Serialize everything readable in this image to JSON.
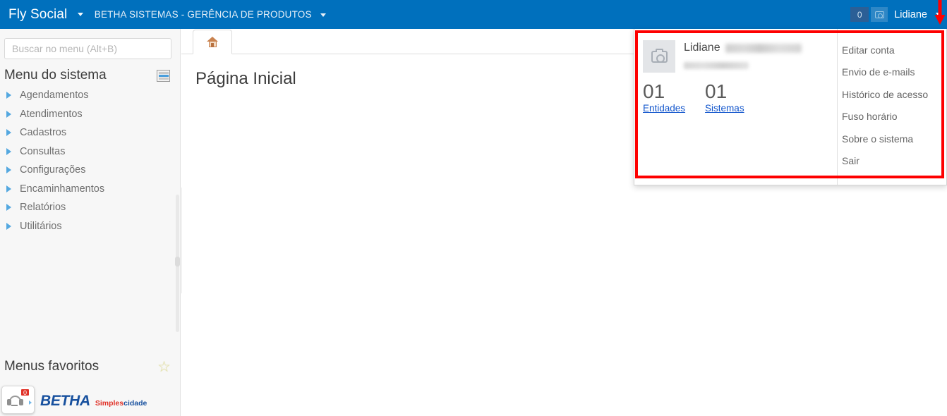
{
  "header": {
    "brand": "Fly Social",
    "entity": "BETHA SISTEMAS - GERÊNCIA DE PRODUTOS",
    "notification_count": "0",
    "user": "Lidiane",
    "camera_icon": "camera-icon",
    "brand_caret_icon": "chevron-down-icon",
    "entity_caret_icon": "chevron-down-icon",
    "user_caret_icon": "chevron-down-icon",
    "background_color": "#0070bd"
  },
  "sidebar": {
    "search": {
      "placeholder": "Buscar no menu (Alt+B)",
      "value": ""
    },
    "menu_title": "Menu do sistema",
    "menu_icon": "list-view-icon",
    "items": [
      {
        "label": "Agendamentos",
        "icon": "triangle-right-icon"
      },
      {
        "label": "Atendimentos",
        "icon": "triangle-right-icon"
      },
      {
        "label": "Cadastros",
        "icon": "triangle-right-icon"
      },
      {
        "label": "Consultas",
        "icon": "triangle-right-icon"
      },
      {
        "label": "Configurações",
        "icon": "triangle-right-icon"
      },
      {
        "label": "Encaminhamentos",
        "icon": "triangle-right-icon"
      },
      {
        "label": "Relatórios",
        "icon": "triangle-right-icon"
      },
      {
        "label": "Utilitários",
        "icon": "triangle-right-icon"
      }
    ],
    "favorites_title": "Menus favoritos",
    "favorites_icon": "star-icon",
    "support": {
      "icon": "headset-icon",
      "badge": "0"
    },
    "logo": {
      "name": "BETHA",
      "tag_first": "Simples",
      "tag_second": "cidade",
      "tag_first_color": "#e03127",
      "tag_second_color": "#17509e"
    }
  },
  "main": {
    "tab_icon": "home-icon",
    "page_title": "Página Inicial"
  },
  "dropdown": {
    "avatar_icon": "camera-placeholder-icon",
    "user_first_name": "Lidiane",
    "user_last_name_redacted": "",
    "user_email_redacted": "",
    "stats": [
      {
        "value": "01",
        "label": "Entidades"
      },
      {
        "value": "01",
        "label": "Sistemas"
      }
    ],
    "items": [
      "Editar conta",
      "Envio de e-mails",
      "Histórico de acesso",
      "Fuso horário",
      "Sobre o sistema",
      "Sair"
    ]
  },
  "annotation": {
    "box_color": "#fe0000",
    "arrow_color": "#fe0000"
  }
}
